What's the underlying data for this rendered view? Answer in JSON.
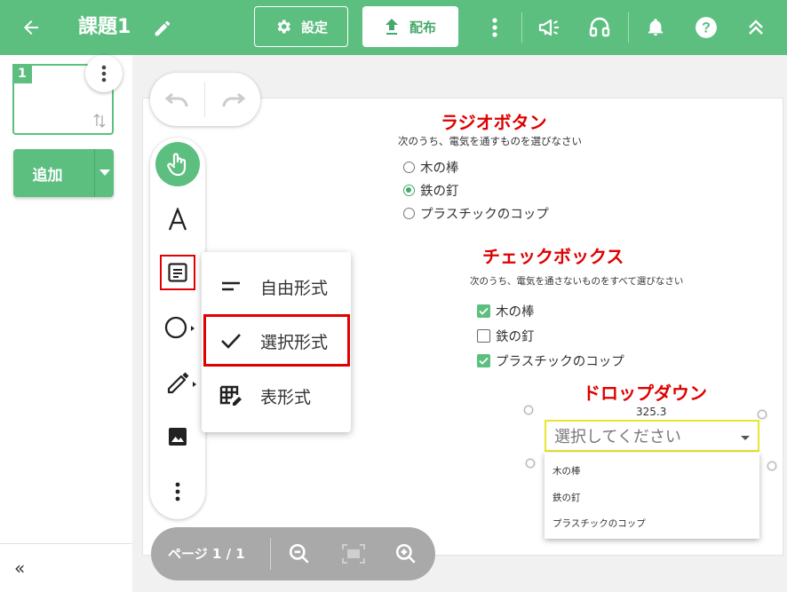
{
  "header": {
    "title": "課題1",
    "settings_label": "設定",
    "publish_label": "配布",
    "colors": {
      "bar": "#5cbf80",
      "accent": "#46a86c"
    }
  },
  "sidebar": {
    "page_number": "1",
    "add_label": "追加",
    "collapse_label": "«"
  },
  "toolbar": {
    "menu_items": [
      {
        "label": "自由形式",
        "icon": "short-text-icon"
      },
      {
        "label": "選択形式",
        "icon": "check-icon"
      },
      {
        "label": "表形式",
        "icon": "table-edit-icon"
      }
    ]
  },
  "content": {
    "radio": {
      "heading": "ラジオボタン",
      "question": "次のうち、電気を通すものを選びなさい",
      "options": [
        "木の棒",
        "鉄の釘",
        "プラスチックのコップ"
      ],
      "selected_index": 1
    },
    "checkbox": {
      "heading": "チェックボックス",
      "question": "次のうち、電気を通さないものをすべて選びなさい",
      "options": [
        "木の棒",
        "鉄の釘",
        "プラスチックのコップ"
      ],
      "checked": [
        true,
        false,
        true
      ]
    },
    "dropdown": {
      "heading": "ドロップダウン",
      "value_label": "325.3",
      "placeholder": "選択してください",
      "options": [
        "木の棒",
        "鉄の釘",
        "プラスチックのコップ"
      ]
    }
  },
  "footer": {
    "page_label": "ページ 1 / 1"
  }
}
